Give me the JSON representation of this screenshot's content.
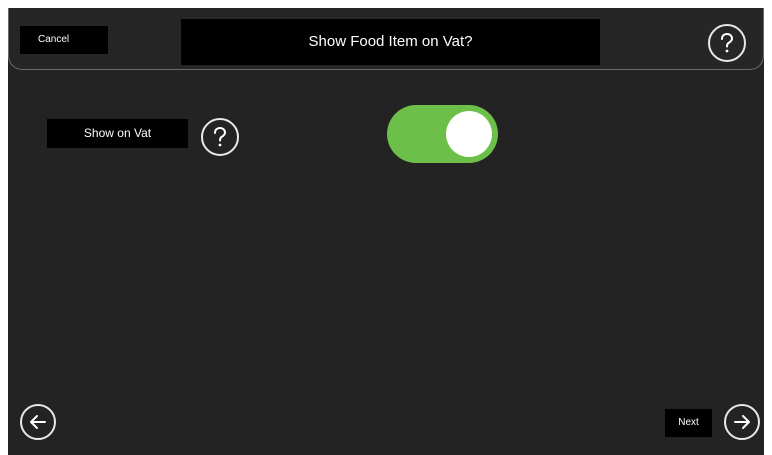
{
  "header": {
    "cancel_label": "Cancel",
    "title": "Show Food Item on Vat?",
    "help_icon": "question-mark-icon"
  },
  "field": {
    "label": "Show on Vat",
    "help_icon": "question-mark-icon",
    "toggle_state": "on"
  },
  "footer": {
    "back_icon": "arrow-left-icon",
    "next_label": "Next",
    "next_icon": "arrow-right-icon"
  },
  "colors": {
    "background": "#232323",
    "toggle_on": "#6cc04a",
    "button_bg": "#000000",
    "text": "#ffffff"
  }
}
